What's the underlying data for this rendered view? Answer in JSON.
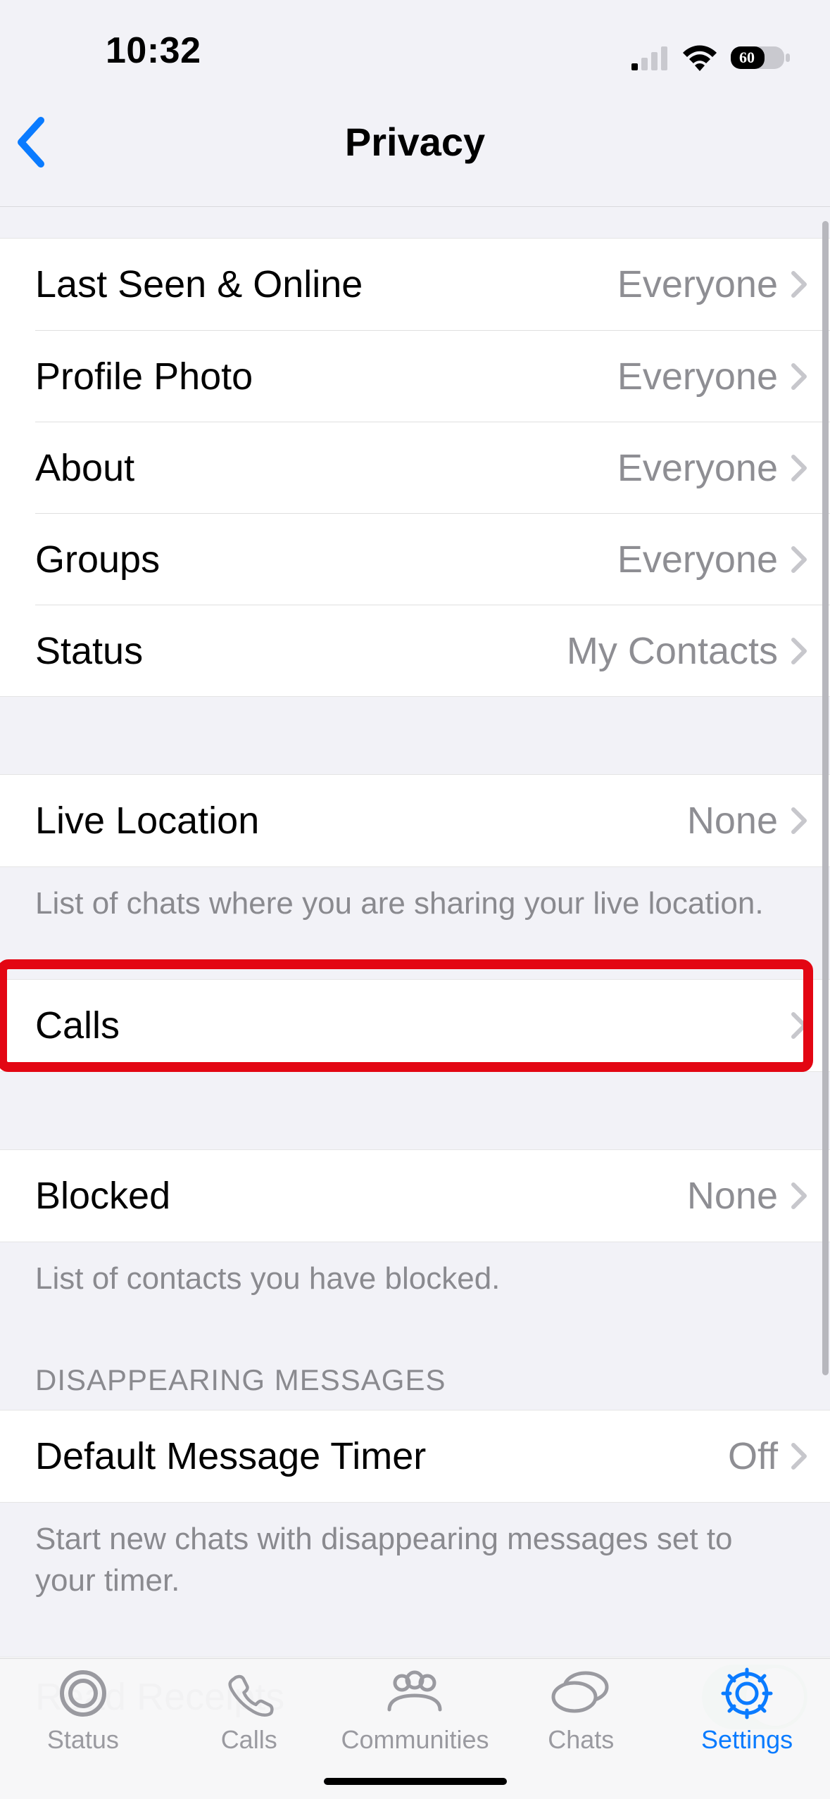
{
  "status_bar": {
    "time": "10:32",
    "battery_percent": "60"
  },
  "header": {
    "title": "Privacy"
  },
  "sections": {
    "group1": [
      {
        "label": "Last Seen & Online",
        "value": "Everyone"
      },
      {
        "label": "Profile Photo",
        "value": "Everyone"
      },
      {
        "label": "About",
        "value": "Everyone"
      },
      {
        "label": "Groups",
        "value": "Everyone"
      },
      {
        "label": "Status",
        "value": "My Contacts"
      }
    ],
    "live_location": {
      "label": "Live Location",
      "value": "None",
      "footer": "List of chats where you are sharing your live location."
    },
    "calls": {
      "label": "Calls"
    },
    "blocked": {
      "label": "Blocked",
      "value": "None",
      "footer": "List of contacts you have blocked."
    },
    "disappearing_header": "DISAPPEARING MESSAGES",
    "default_timer": {
      "label": "Default Message Timer",
      "value": "Off",
      "footer": "Start new chats with disappearing messages set to your timer."
    },
    "read_receipts": {
      "label": "Read Receipts",
      "toggle": true
    }
  },
  "tabs": {
    "status": "Status",
    "calls": "Calls",
    "communities": "Communities",
    "chats": "Chats",
    "settings": "Settings"
  }
}
